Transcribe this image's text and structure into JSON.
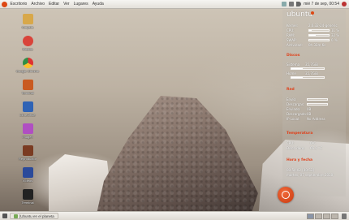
{
  "top_panel": {
    "menus": [
      "Escritorio",
      "Archivo",
      "Editar",
      "Ver",
      "Lugares",
      "Ayuda"
    ],
    "clock": "mié 7 de sep, 00:54"
  },
  "desktop_icons": [
    {
      "label": "Carpeta",
      "icon": "folder-icon",
      "color": "#d8a84a"
    },
    {
      "label": "Música",
      "icon": "music-icon",
      "color": "#d9443a"
    },
    {
      "label": "Google Chrome",
      "icon": "chrome-icon",
      "color": "#2f8f46"
    },
    {
      "label": "Terminal",
      "icon": "terminal-icon",
      "color": "#c95a20"
    },
    {
      "label": "LibreOffice",
      "icon": "office-icon",
      "color": "#2f63b5"
    },
    {
      "label": "Imagen",
      "icon": "image-icon",
      "color": "#b04fc2"
    },
    {
      "label": "Reproductor",
      "icon": "player-icon",
      "color": "#7a3b22"
    },
    {
      "label": "Vídeos",
      "icon": "video-icon",
      "color": "#2b4a9a"
    },
    {
      "label": "Terminal",
      "icon": "console-icon",
      "color": "#222222"
    }
  ],
  "conky": {
    "brand": "ubuntu",
    "system": {
      "kernel_label": "Kernel:",
      "kernel_value": "2.6.32-24-generic",
      "cpu_label": "CPU:",
      "cpu_value": "11 %",
      "cpu_percent": 11,
      "ram_label": "RAM:",
      "ram_value": "32 %",
      "ram_percent": 32,
      "swap_label": "SWAP:",
      "swap_value": "0 %",
      "swap_percent": 0,
      "uptime_label": "Actividad:",
      "uptime_value": "0h 33m 6s"
    },
    "disk_header": "Discos",
    "disks": [
      {
        "label": "Sistema",
        "value": "35,7GiB",
        "percent": 35
      },
      {
        "label": "Home",
        "value": "35,7GiB",
        "percent": 35
      }
    ],
    "net_header": "Red",
    "net": {
      "up_label": "Envío:",
      "down_label": "Descargas:",
      "sent_label": "Enviado:",
      "sent_value": "0B",
      "received_label": "Descargado:",
      "received_value": "0B",
      "ip_label": "IP Local:",
      "ip_value": "No Address"
    },
    "temp_header": "Temperatura",
    "temp": {
      "cpu_label": "CPU:",
      "cpu_value": "0ºC",
      "disk_label": "Disco duro:",
      "disk_value": "66.0 ºC"
    },
    "date_header": "Hora y fecha",
    "time": "00:54:02 [00:53]",
    "date": "martes, 07 septiembre 2010"
  },
  "bottom_panel": {
    "task_label": "[Ubuntu en el planeta"
  },
  "colors": {
    "accent": "#dd4814",
    "panel": "#e8e5df"
  }
}
